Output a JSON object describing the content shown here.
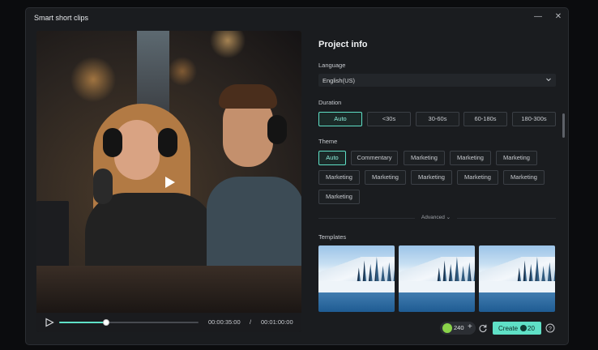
{
  "dialog": {
    "title": "Smart short clips",
    "minimize_icon": "minimize-icon",
    "close_icon": "close-icon"
  },
  "player": {
    "current_time": "00:00:35:00",
    "separator": "/",
    "total_time": "00:01:00:00",
    "progress_fraction": 0.34
  },
  "panel": {
    "title": "Project info",
    "language": {
      "label": "Language",
      "value": "English(US)"
    },
    "duration": {
      "label": "Duration",
      "options": [
        "Auto",
        "<30s",
        "30-60s",
        "60-180s",
        "180-300s"
      ],
      "selected": "Auto"
    },
    "theme": {
      "label": "Theme",
      "options": [
        "Auto",
        "Commentary",
        "Marketing",
        "Marketing",
        "Marketing",
        "Marketing",
        "Marketing",
        "Marketing",
        "Marketing",
        "Marketing",
        "Marketing"
      ],
      "selected": "Auto"
    },
    "advanced_label": "Advanced",
    "templates_label": "Templates"
  },
  "footer": {
    "credits": "240",
    "create_label": "Create",
    "create_cost": "20"
  },
  "colors": {
    "accent": "#5fe0c6",
    "background": "#1a1c1f"
  }
}
